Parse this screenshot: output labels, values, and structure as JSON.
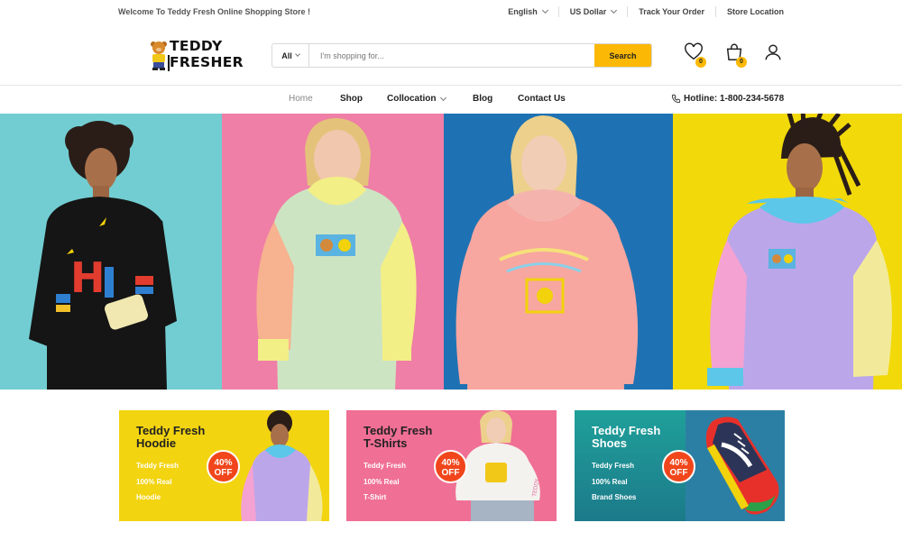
{
  "topbar": {
    "welcome": "Welcome To Teddy Fresh Online Shopping Store !",
    "language": "English",
    "currency": "US Dollar",
    "track_order": "Track Your Order",
    "store_location": "Store Location"
  },
  "logo": {
    "line1": "TEDDY",
    "line2": "FRESHER"
  },
  "search": {
    "category": "All",
    "placeholder": "I'm shopping for...",
    "button": "Search"
  },
  "header_icons": {
    "wishlist_count": "0",
    "cart_count": "0"
  },
  "nav": {
    "items": [
      {
        "label": "Home"
      },
      {
        "label": "Shop"
      },
      {
        "label": "Collocation"
      },
      {
        "label": "Blog"
      },
      {
        "label": "Contact Us"
      }
    ],
    "hotline_label": "Hotline:",
    "hotline_number": "1-800-234-5678"
  },
  "promos": [
    {
      "title1": "Teddy Fresh",
      "title2": "Hoodie",
      "line1": "Teddy Fresh",
      "line2": "100% Real",
      "line3": "Hoodie",
      "badge1": "40%",
      "badge2": "OFF"
    },
    {
      "title1": "Teddy Fresh",
      "title2": "T-Shirts",
      "line1": "Teddy Fresh",
      "line2": "100% Real",
      "line3": "T-Shirt",
      "badge1": "40%",
      "badge2": "OFF"
    },
    {
      "title1": "Teddy Fresh",
      "title2": "Shoes",
      "line1": "Teddy Fresh",
      "line2": "100% Real",
      "line3": "Brand Shoes",
      "badge1": "40%",
      "badge2": "OFF"
    }
  ],
  "colors": {
    "accent": "#fbb905",
    "badge": "#f1461b",
    "hero_panels": [
      "#72cdd2",
      "#ef7fa6",
      "#1e72b3",
      "#f2d90a"
    ],
    "promo_backgrounds": [
      "#f3d411",
      "#f06f95",
      "#1f8f93"
    ]
  }
}
